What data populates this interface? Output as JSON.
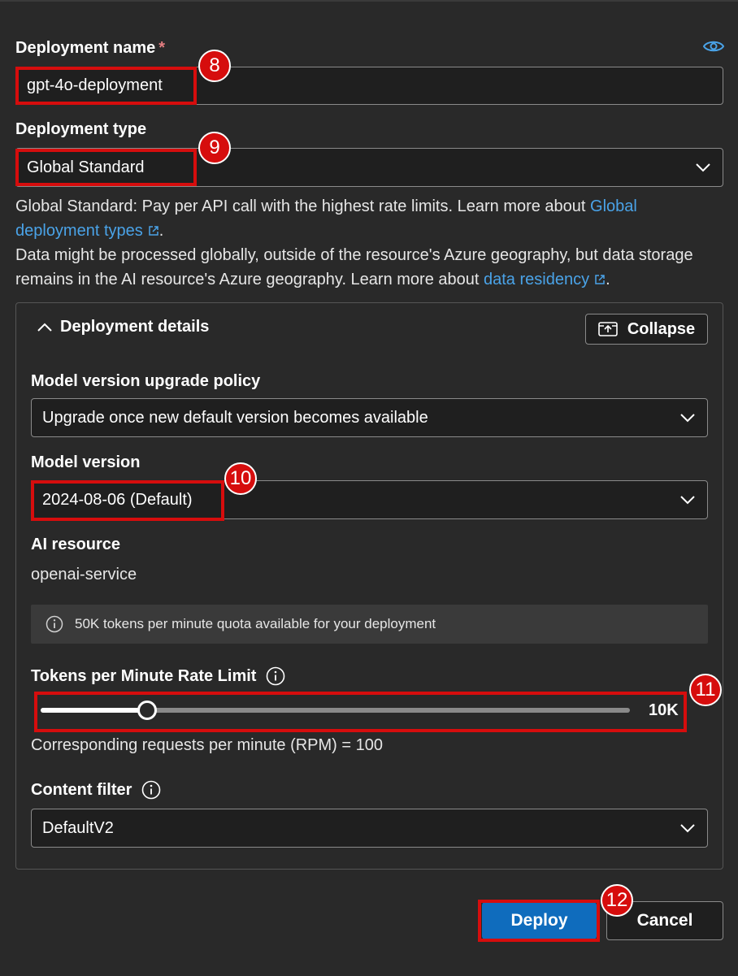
{
  "deployment_name": {
    "label": "Deployment name",
    "required_mark": "*",
    "value": "gpt-4o-deployment"
  },
  "deployment_type": {
    "label": "Deployment type",
    "value": "Global Standard",
    "desc_prefix": "Global Standard: Pay per API call with the highest rate limits. Learn more about ",
    "desc_link": "Global deployment types",
    "desc_suffix": ".",
    "data_prefix": "Data might be processed globally, outside of the resource's Azure geography, but data storage remains in the AI resource's Azure geography. Learn more about ",
    "data_link": "data residency",
    "data_suffix": "."
  },
  "details": {
    "title": "Deployment details",
    "collapse_label": "Collapse",
    "upgrade_policy": {
      "label": "Model version upgrade policy",
      "value": "Upgrade once new default version becomes available"
    },
    "model_version": {
      "label": "Model version",
      "value": "2024-08-06 (Default)"
    },
    "ai_resource": {
      "label": "AI resource",
      "value": "openai-service"
    },
    "quota_info": "50K tokens per minute quota available for your deployment",
    "rate_limit": {
      "label": "Tokens per Minute Rate Limit",
      "value_label": "10K",
      "fraction": 0.18,
      "rpm_text": "Corresponding requests per minute (RPM) = 100"
    },
    "content_filter": {
      "label": "Content filter",
      "value": "DefaultV2"
    }
  },
  "actions": {
    "deploy_label": "Deploy",
    "cancel_label": "Cancel"
  },
  "callouts": [
    "8",
    "9",
    "10",
    "11",
    "12"
  ],
  "colors": {
    "accent": "#0f6cbd",
    "link": "#4aa3e8",
    "highlight": "#d60d0d"
  }
}
